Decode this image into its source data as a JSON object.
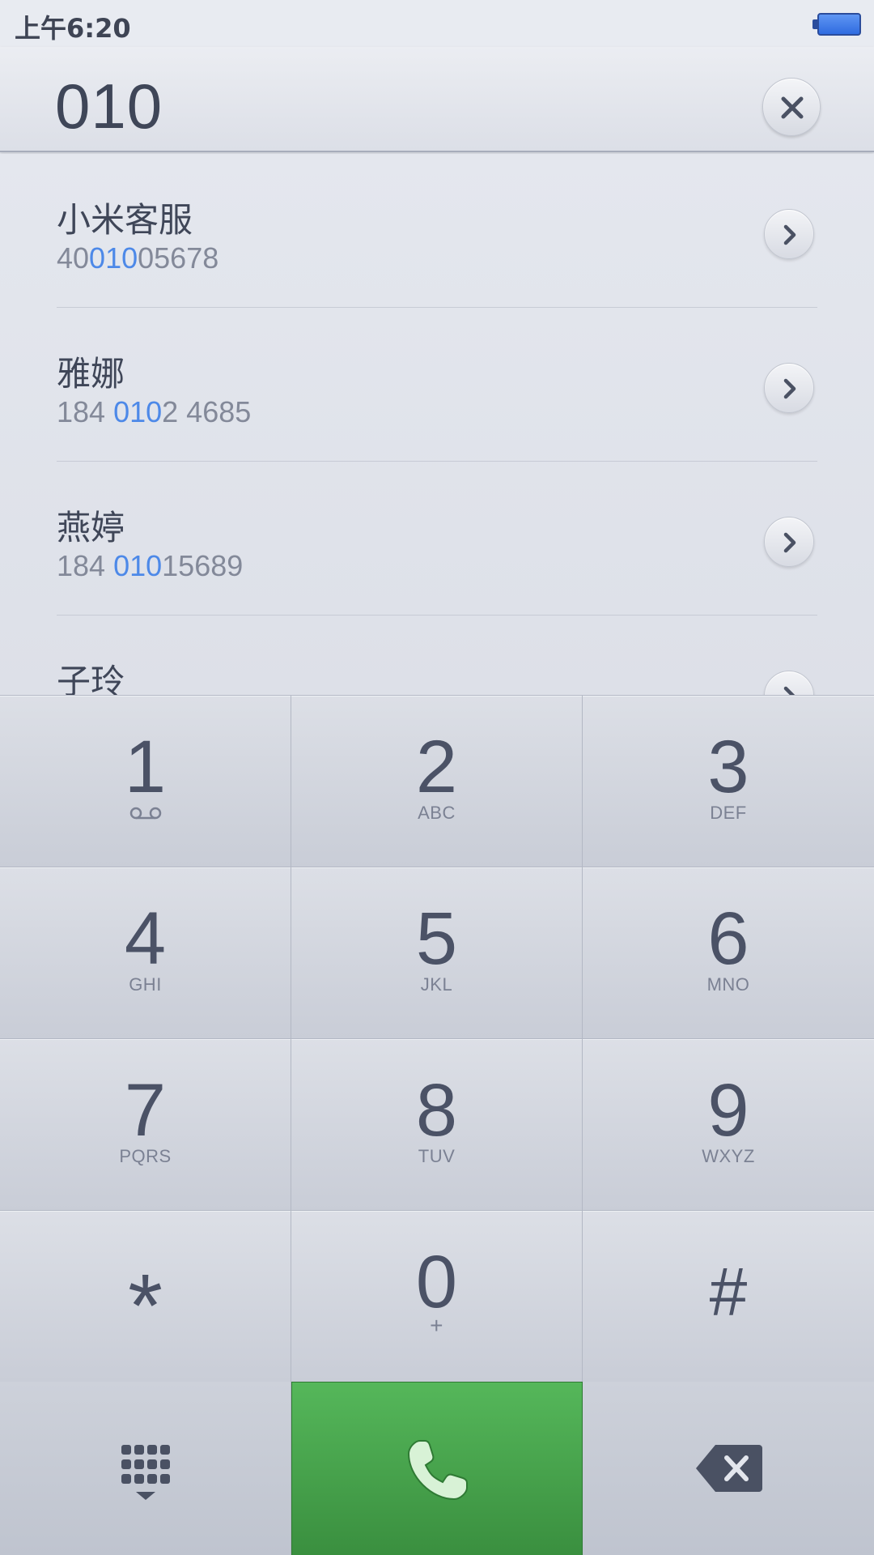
{
  "status_bar": {
    "time": "上午6:20"
  },
  "dialer": {
    "input_value": "010"
  },
  "results": [
    {
      "name": "小米客服",
      "number_parts": [
        "40",
        "010",
        "05678"
      ]
    },
    {
      "name": "雅娜",
      "number_parts": [
        "184 ",
        "010",
        "2 4685"
      ]
    },
    {
      "name": "燕婷",
      "number_parts": [
        "184 ",
        "010",
        "15689"
      ]
    },
    {
      "name": "子玲",
      "number_parts": [
        "",
        "",
        ""
      ]
    }
  ],
  "keypad": {
    "keys": [
      {
        "digit": "1",
        "letters": ""
      },
      {
        "digit": "2",
        "letters": "ABC"
      },
      {
        "digit": "3",
        "letters": "DEF"
      },
      {
        "digit": "4",
        "letters": "GHI"
      },
      {
        "digit": "5",
        "letters": "JKL"
      },
      {
        "digit": "6",
        "letters": "MNO"
      },
      {
        "digit": "7",
        "letters": "PQRS"
      },
      {
        "digit": "8",
        "letters": "TUV"
      },
      {
        "digit": "9",
        "letters": "WXYZ"
      },
      {
        "digit": "*",
        "letters": ""
      },
      {
        "digit": "0",
        "letters": "+"
      },
      {
        "digit": "#",
        "letters": ""
      }
    ]
  },
  "icons": {
    "battery": "battery-icon",
    "clear": "close-icon",
    "chevron": "chevron-right-icon",
    "voicemail": "voicemail-icon",
    "keypad_toggle": "keypad-icon",
    "call": "phone-icon",
    "backspace": "backspace-icon"
  },
  "colors": {
    "highlight": "#4d89e8",
    "call_green": "#4aa84f",
    "battery_blue": "#3a74e6"
  }
}
